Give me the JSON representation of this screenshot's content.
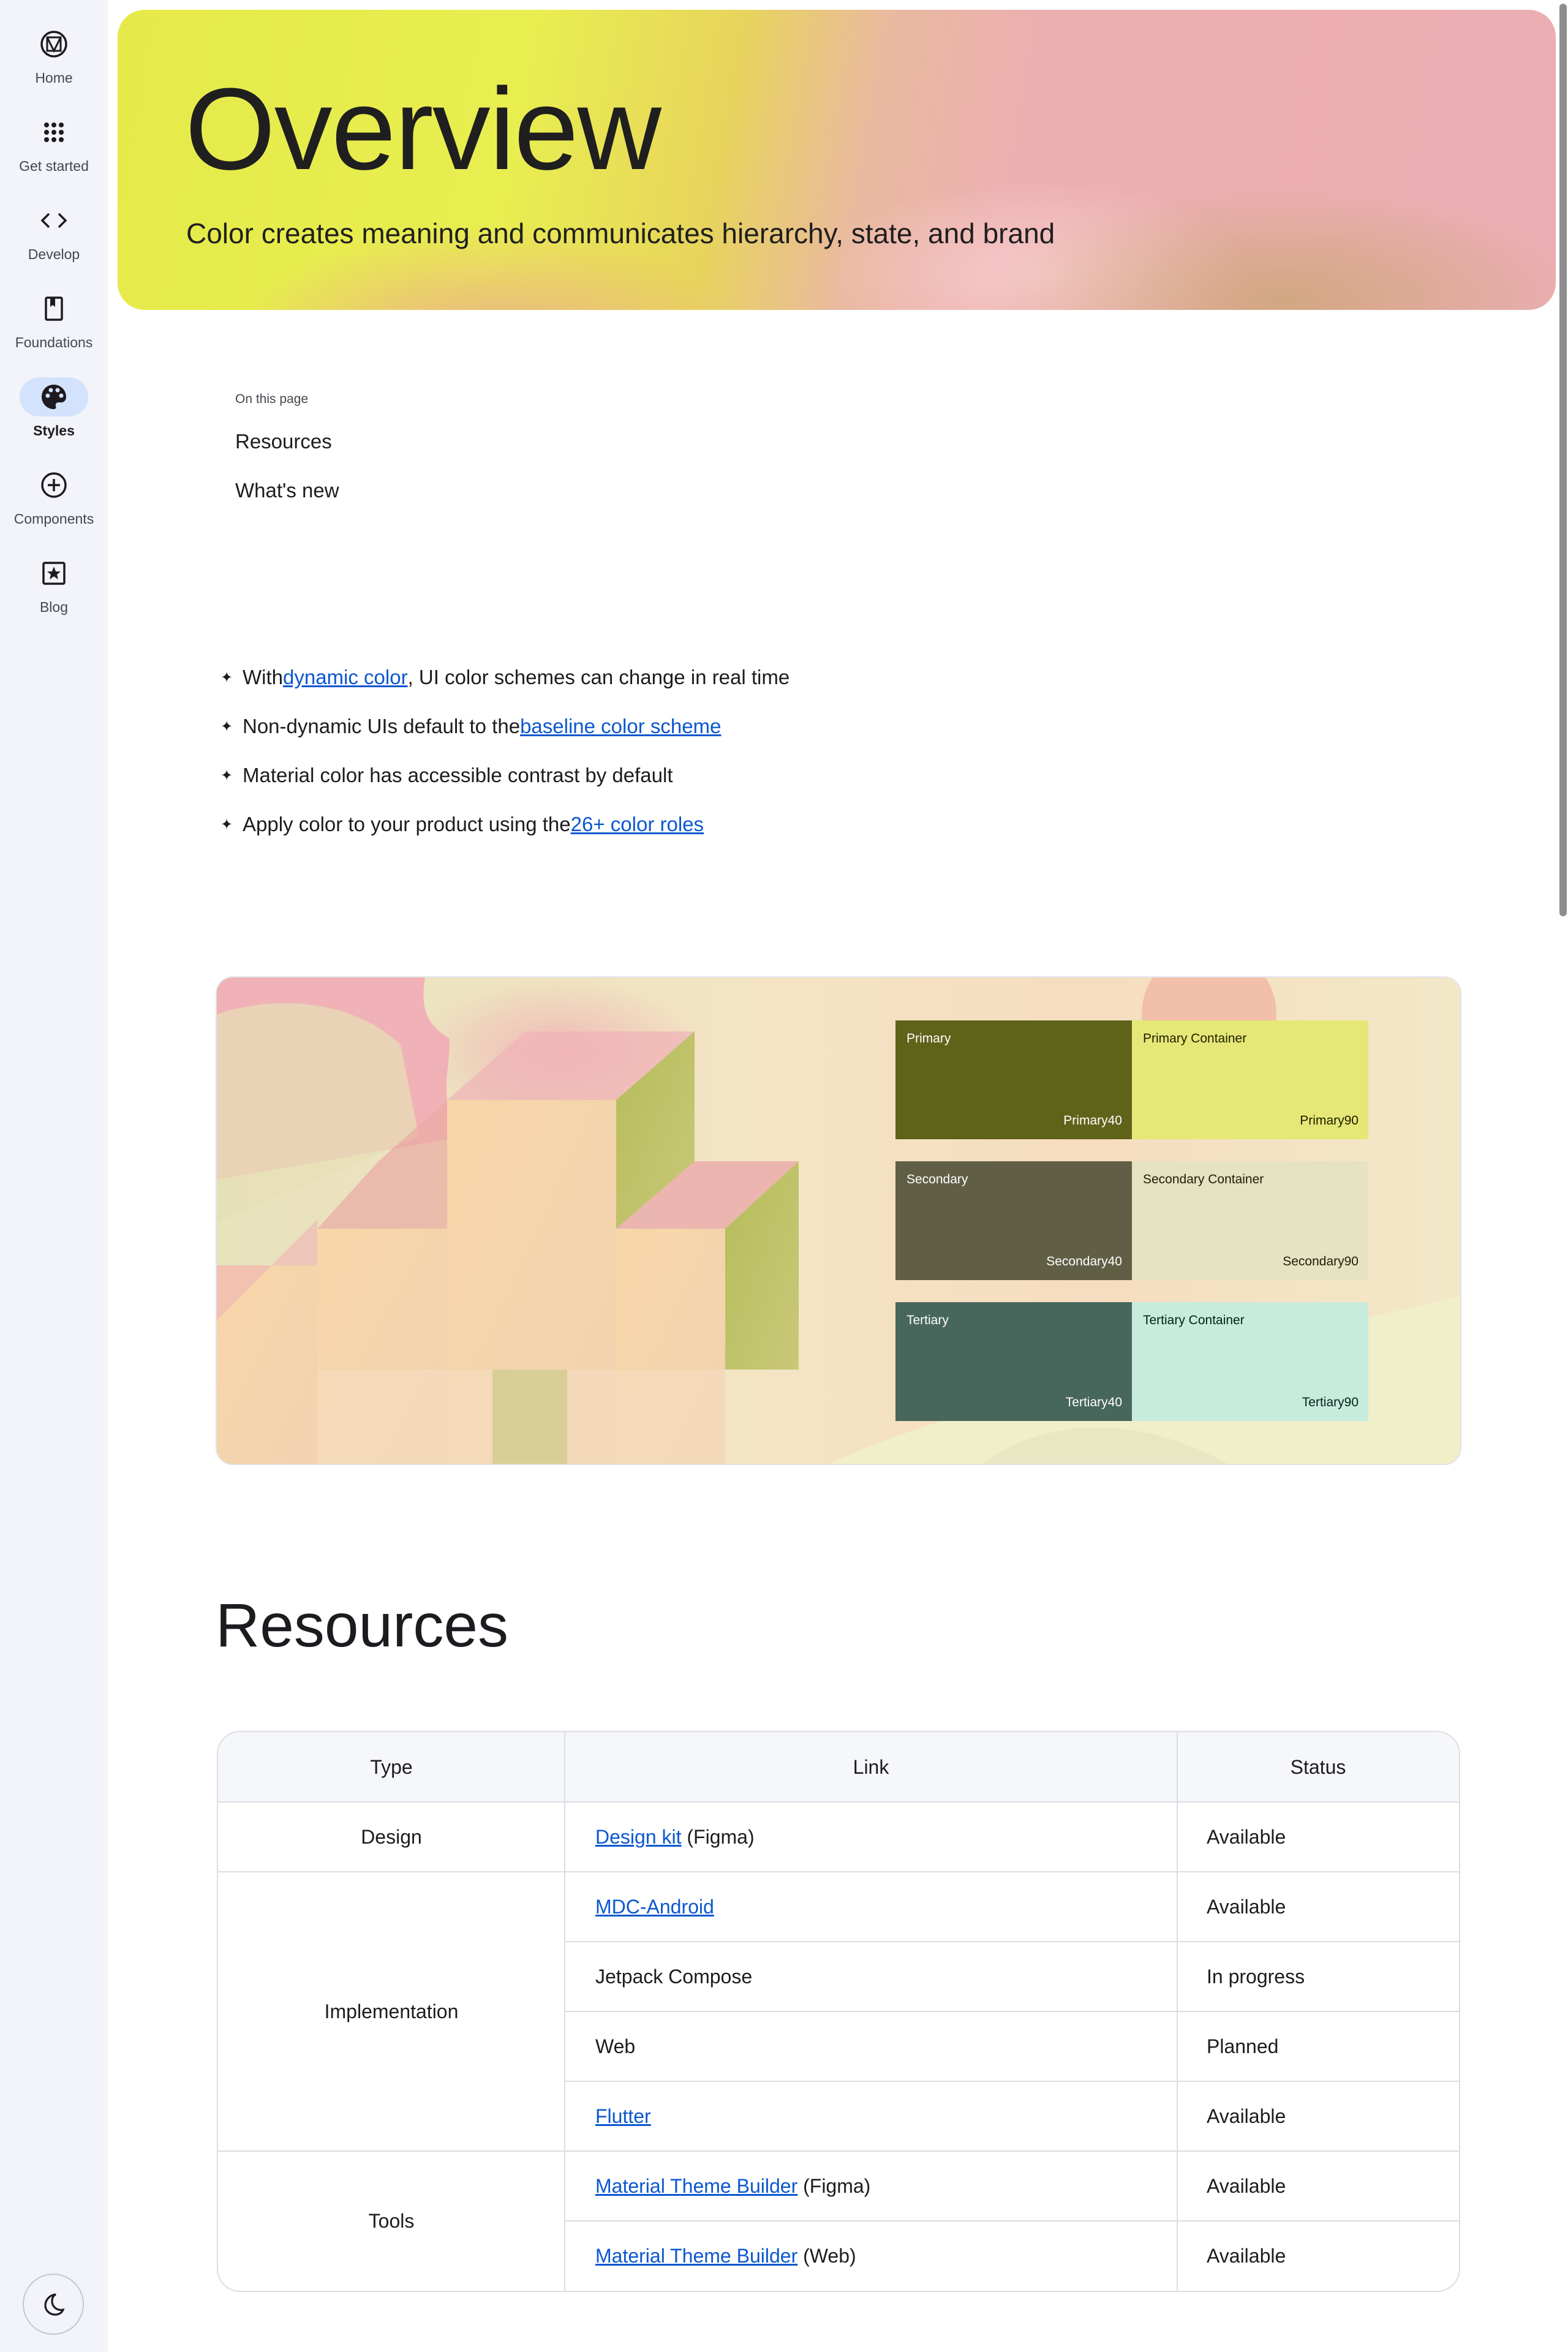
{
  "nav": {
    "items": [
      {
        "label": "Home",
        "icon": "material-logo-icon"
      },
      {
        "label": "Get started",
        "icon": "apps-grid-icon"
      },
      {
        "label": "Develop",
        "icon": "code-icon"
      },
      {
        "label": "Foundations",
        "icon": "book-icon"
      },
      {
        "label": "Styles",
        "icon": "palette-icon",
        "active": true
      },
      {
        "label": "Components",
        "icon": "add-circle-icon"
      },
      {
        "label": "Blog",
        "icon": "star-box-icon"
      }
    ],
    "theme_toggle_icon": "dark-mode-moon-icon"
  },
  "hero": {
    "title": "Overview",
    "subtitle": "Color creates meaning and communicates hierarchy, state, and brand"
  },
  "toc": {
    "heading": "On this page",
    "links": [
      "Resources",
      "What's new"
    ]
  },
  "bullets": [
    {
      "pre": "With ",
      "link": "dynamic color",
      "post": ", UI color schemes can change in real time"
    },
    {
      "pre": "Non-dynamic UIs default to the ",
      "link": "baseline color scheme",
      "post": ""
    },
    {
      "pre": "Material color has accessible contrast by default",
      "link": "",
      "post": ""
    },
    {
      "pre": "Apply color to your product using the ",
      "link": "26+ color roles",
      "post": ""
    }
  ],
  "swatches": [
    {
      "name": "Primary",
      "tone": "Primary40",
      "bg": "#5f6319",
      "fg": "#ffffff"
    },
    {
      "name": "Primary Container",
      "tone": "Primary90",
      "bg": "#e5e877",
      "fg": "#1d1d00"
    },
    {
      "name": "Secondary",
      "tone": "Secondary40",
      "bg": "#605f45",
      "fg": "#ffffff"
    },
    {
      "name": "Secondary Container",
      "tone": "Secondary90",
      "bg": "#e6e3c3",
      "fg": "#1d1d07"
    },
    {
      "name": "Tertiary",
      "tone": "Tertiary40",
      "bg": "#47665c",
      "fg": "#ffffff"
    },
    {
      "name": "Tertiary Container",
      "tone": "Tertiary90",
      "bg": "#c8ecdc",
      "fg": "#04201a"
    }
  ],
  "resources": {
    "title": "Resources",
    "headers": {
      "type": "Type",
      "link": "Link",
      "status": "Status"
    },
    "groups": [
      {
        "type": "Design"
      },
      {
        "type": "Implementation"
      },
      {
        "type": "Tools"
      }
    ],
    "rows": [
      {
        "link": "Design kit",
        "suffix": " (Figma)",
        "is_link": true,
        "status": "Available"
      },
      {
        "link": "MDC-Android",
        "suffix": "",
        "is_link": true,
        "status": "Available"
      },
      {
        "link": "Jetpack Compose",
        "suffix": "",
        "is_link": false,
        "status": "In progress"
      },
      {
        "link": "Web",
        "suffix": "",
        "is_link": false,
        "status": "Planned"
      },
      {
        "link": "Flutter",
        "suffix": "",
        "is_link": true,
        "status": "Available"
      },
      {
        "link": "Material Theme Builder",
        "suffix": " (Figma)",
        "is_link": true,
        "status": "Available"
      },
      {
        "link": "Material Theme Builder",
        "suffix": " (Web)",
        "is_link": true,
        "status": "Available"
      }
    ]
  }
}
